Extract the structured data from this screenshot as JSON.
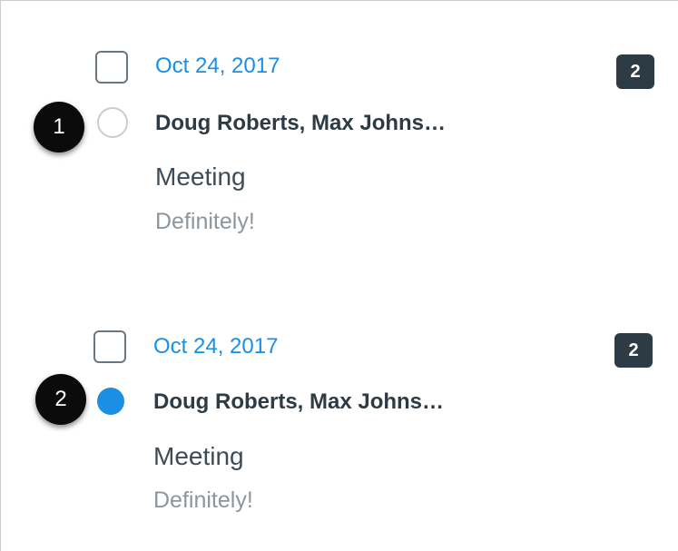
{
  "conversations": [
    {
      "date": "Oct 24, 2017",
      "participants": "Doug Roberts, Max Johns…",
      "subject": "Meeting",
      "preview": "Definitely!",
      "message_count": "2",
      "read_state": "read",
      "callout_number": "1"
    },
    {
      "date": "Oct 24, 2017",
      "participants": "Doug Roberts, Max Johns…",
      "subject": "Meeting",
      "preview": "Definitely!",
      "message_count": "2",
      "read_state": "unread",
      "callout_number": "2"
    }
  ],
  "colors": {
    "accent": "#1a8fe3",
    "badge": "#2d3b45",
    "text_primary": "#2d3b45",
    "text_muted": "#8b969e",
    "border": "#c7cdd1"
  },
  "icons": {
    "read": "read-indicator-icon",
    "unread": "unread-indicator-icon",
    "select": "checkbox"
  }
}
